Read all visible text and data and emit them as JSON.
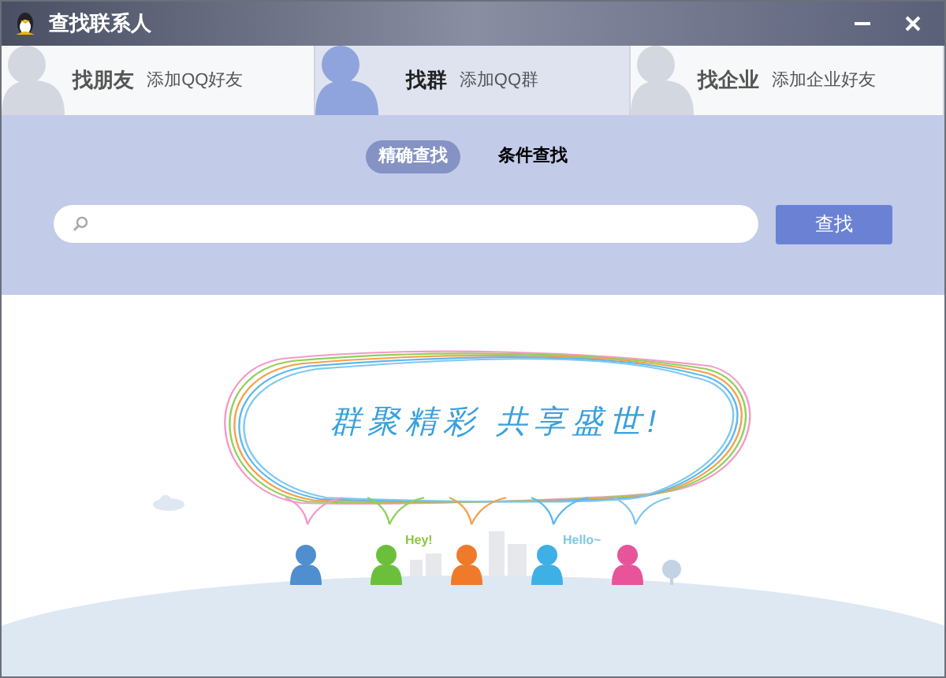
{
  "window": {
    "title": "查找联系人"
  },
  "tabs": [
    {
      "title": "找朋友",
      "subtitle": "添加QQ好友",
      "selected": false
    },
    {
      "title": "找群",
      "subtitle": "添加QQ群",
      "selected": true
    },
    {
      "title": "找企业",
      "subtitle": "添加企业好友",
      "selected": false
    }
  ],
  "search_modes": [
    {
      "label": "精确查找",
      "selected": true
    },
    {
      "label": "条件查找",
      "selected": false
    }
  ],
  "search": {
    "button": "查找"
  },
  "banner": {
    "slogan": "群聚精彩 共享盛世!",
    "greetings": [
      "Hey!",
      "Hello~"
    ]
  }
}
